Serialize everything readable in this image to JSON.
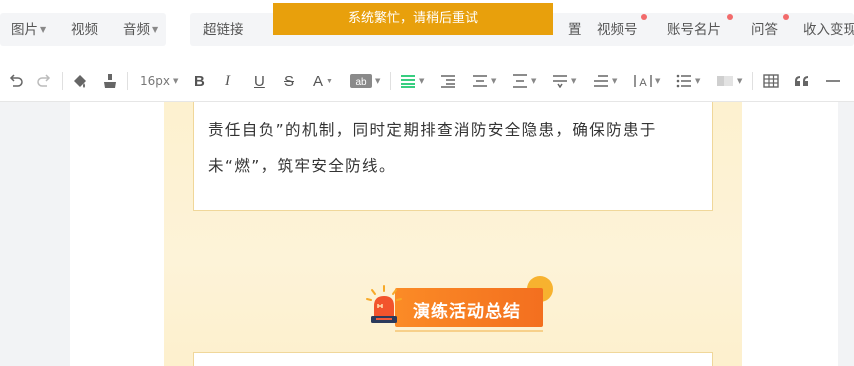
{
  "insert_bar": {
    "left_items": [
      {
        "label": "图片",
        "has_caret": true
      },
      {
        "label": "视频",
        "has_caret": false
      },
      {
        "label": "音频",
        "has_caret": true
      }
    ],
    "right_items": [
      {
        "label": "超链接",
        "has_dot": false
      },
      {
        "label": "置",
        "has_dot": false
      },
      {
        "label": "视频号",
        "has_dot": true
      },
      {
        "label": "账号名片",
        "has_dot": true
      },
      {
        "label": "问答",
        "has_dot": true
      },
      {
        "label": "收入变现",
        "has_dot": false
      }
    ]
  },
  "toast": {
    "message": "系统繁忙，请稍后重试"
  },
  "format_toolbar": {
    "font_size": "16px",
    "icons": [
      "undo-icon",
      "redo-icon",
      "format-painter-icon",
      "clear-format-icon",
      "font-size-select",
      "bold-icon",
      "italic-icon",
      "underline-icon",
      "strikethrough-icon",
      "font-color-icon",
      "background-color-icon",
      "align-icon",
      "indent-icon",
      "justify-icon",
      "line-height-icon",
      "paragraph-spacing-icon",
      "first-line-indent-icon",
      "letter-spacing-icon",
      "list-icon",
      "border-shading-icon",
      "table-icon",
      "quote-icon",
      "divider-icon"
    ],
    "accent_color": "#07c160"
  },
  "article": {
    "line1": "责任自负”的机制，同时定期排查消防安全隐患，确保防患于",
    "line2": "未“燃”，筑牢安全防线。",
    "section_title": "演练活动总结",
    "section_icon": "alarm-light-icon"
  },
  "colors": {
    "toast": "#e8a00c",
    "article_background": "#fdf1cf",
    "section_banner": "#f57a22",
    "card_border": "#f0d79a"
  }
}
